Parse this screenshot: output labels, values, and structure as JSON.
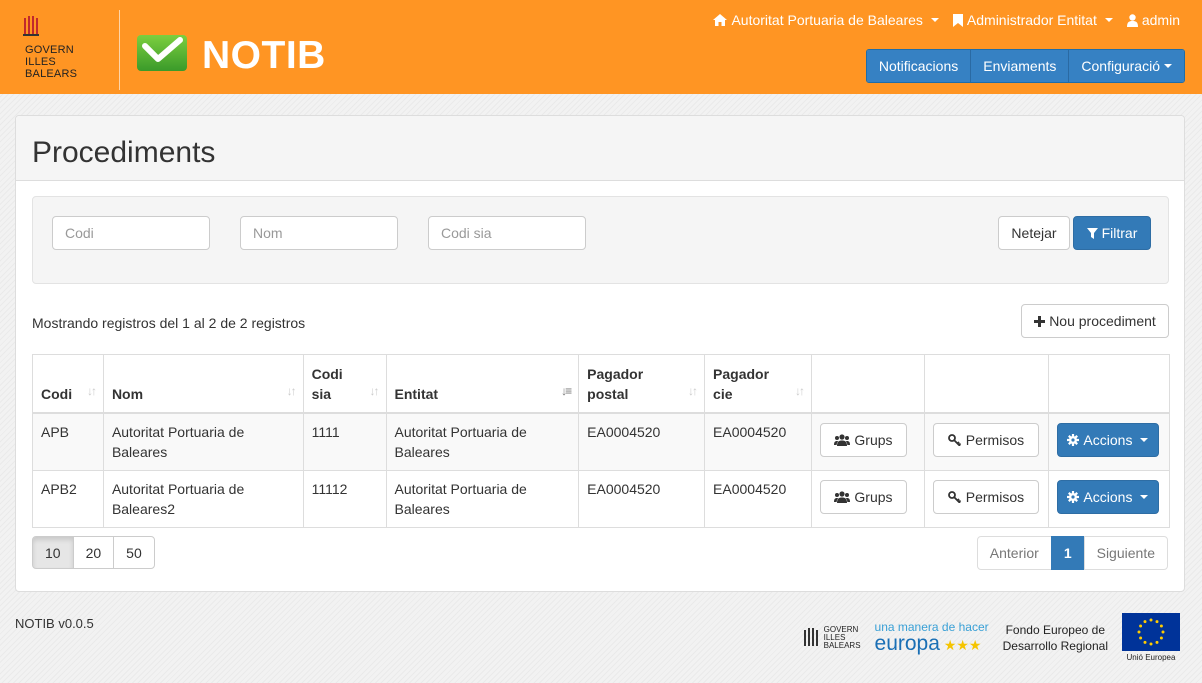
{
  "header": {
    "govern_logo_text": "GOVERN\nILLES\nBALEARS",
    "app_title": "NOTIB",
    "top_menu": {
      "entity": "Autoritat Portuaria de Baleares",
      "role": "Administrador Entitat",
      "user": "admin"
    },
    "nav": {
      "notificacions": "Notificacions",
      "enviaments": "Enviaments",
      "configuracio": "Configuració"
    }
  },
  "page": {
    "title": "Procediments"
  },
  "filters": {
    "codi_placeholder": "Codi",
    "nom_placeholder": "Nom",
    "codi_sia_placeholder": "Codi sia",
    "clear_label": "Netejar",
    "filter_label": "Filtrar"
  },
  "records_info": "Mostrando registros del 1 al 2 de 2 registros",
  "new_button_label": "Nou procediment",
  "table": {
    "headers": {
      "codi": "Codi",
      "nom": "Nom",
      "codi_sia_1": "Codi",
      "codi_sia_2": "sia",
      "entitat": "Entitat",
      "pagador_postal_1": "Pagador",
      "pagador_postal_2": "postal",
      "pagador_cie_1": "Pagador",
      "pagador_cie_2": "cie"
    },
    "rows": [
      {
        "codi": "APB",
        "nom": "Autoritat Portuaria de Baleares",
        "codi_sia": "1111",
        "entitat": "Autoritat Portuaria de Baleares",
        "pagador_postal": "EA0004520",
        "pagador_cie": "EA0004520",
        "grups": "Grups",
        "permisos": "Permisos",
        "accions": "Accions"
      },
      {
        "codi": "APB2",
        "nom": "Autoritat Portuaria de Baleares2",
        "codi_sia": "11112",
        "entitat": "Autoritat Portuaria de Baleares",
        "pagador_postal": "EA0004520",
        "pagador_cie": "EA0004520",
        "grups": "Grups",
        "permisos": "Permisos",
        "accions": "Accions"
      }
    ]
  },
  "page_size_options": [
    "10",
    "20",
    "50"
  ],
  "page_size_selected": "10",
  "pagination": {
    "prev": "Anterior",
    "current": "1",
    "next": "Siguiente"
  },
  "footer": {
    "version": "NOTIB v0.0.5",
    "govern_logo_text": "GOVERN\nILLES\nBALEARS",
    "europa_small": "una manera de hacer",
    "europa_big": "europa",
    "fondo_line1": "Fondo Europeo de",
    "fondo_line2": "Desarrollo Regional",
    "eu_label": "Unió Europea"
  },
  "colors": {
    "header_bg": "#ff9523",
    "primary": "#337ab7",
    "notib_green": "#5bb53b"
  }
}
